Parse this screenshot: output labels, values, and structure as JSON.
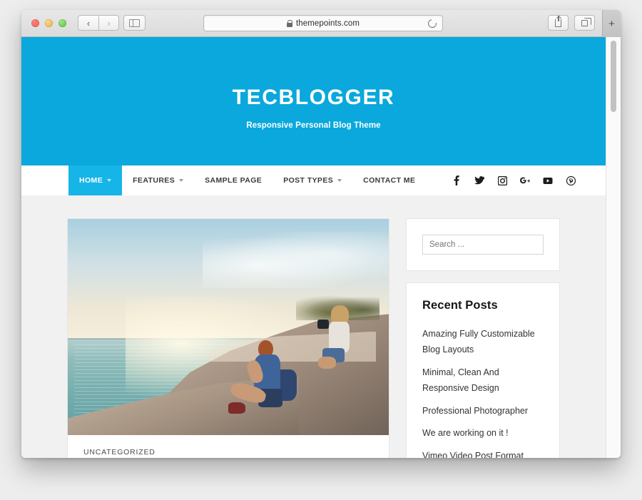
{
  "browser": {
    "url": "themepoints.com",
    "lock_icon": "lock-icon",
    "reload_icon": "reload-icon",
    "back_glyph": "‹",
    "forward_glyph": "›",
    "sidebar_icon": "sidebar-toggle-icon",
    "share_icon": "share-icon",
    "tabs_icon": "tabs-overview-icon",
    "new_tab_label": "+",
    "traffic_lights": [
      "close",
      "minimize",
      "maximize"
    ]
  },
  "site": {
    "title": "TECBLOGGER",
    "tagline": "Responsive Personal Blog Theme",
    "header_color": "#0aa8dc",
    "accent_color": "#16b5e8"
  },
  "nav": {
    "items": [
      {
        "label": "HOME",
        "has_caret": true,
        "active": true
      },
      {
        "label": "FEATURES",
        "has_caret": true,
        "active": false
      },
      {
        "label": "SAMPLE PAGE",
        "has_caret": false,
        "active": false
      },
      {
        "label": "POST TYPES",
        "has_caret": true,
        "active": false
      },
      {
        "label": "CONTACT ME",
        "has_caret": false,
        "active": false
      }
    ],
    "social": [
      {
        "name": "facebook-icon",
        "glyph": "f"
      },
      {
        "name": "twitter-icon",
        "glyph": "🐦"
      },
      {
        "name": "instagram-icon",
        "glyph": "▣"
      },
      {
        "name": "googleplus-icon",
        "glyph": "g+"
      },
      {
        "name": "youtube-icon",
        "glyph": "▶"
      },
      {
        "name": "pinterest-icon",
        "glyph": "Ⓟ"
      }
    ]
  },
  "main": {
    "post": {
      "image_alt": "Two people sitting on coastal rocks photographing the sea at sunset",
      "category": "UNCATEGORIZED"
    }
  },
  "sidebar": {
    "search": {
      "placeholder": "Search ...",
      "value": ""
    },
    "recent_posts": {
      "title": "Recent Posts",
      "items": [
        "Amazing Fully Customizable Blog Layouts",
        "Minimal, Clean And Responsive Design",
        "Professional Photographer",
        "We are working on it !",
        "Vimeo Video Post Format"
      ]
    }
  }
}
